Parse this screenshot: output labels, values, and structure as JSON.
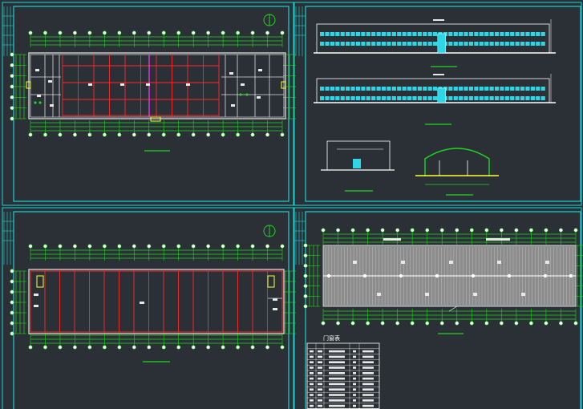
{
  "view": {
    "background": "#2b3036",
    "colors": {
      "frame": "#19d4d4",
      "dim": "#1fd61f",
      "wall": "#ff2a2a",
      "grid": "#ffffff",
      "accent": "#ff3cff",
      "tag": "#ffff33",
      "label": "#e8e8e8"
    }
  },
  "sheets": [
    {
      "id": "floor-plan-1",
      "kind": "floor-plan"
    },
    {
      "id": "elevations",
      "kind": "elevations-and-sections"
    },
    {
      "id": "floor-plan-2",
      "kind": "floor-plan"
    },
    {
      "id": "roof-plan",
      "kind": "roof-plan-and-door-window-table"
    }
  ],
  "door_window_table": {
    "title": "门窗表",
    "rows": 12
  }
}
